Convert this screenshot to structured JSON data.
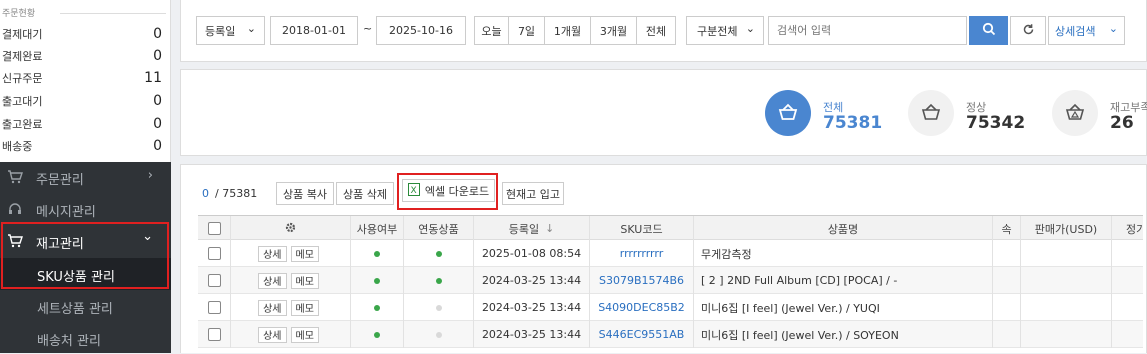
{
  "summary": {
    "title": "주문현황",
    "rows": [
      {
        "label": "결제대기",
        "count": "0"
      },
      {
        "label": "결제완료",
        "count": "0"
      },
      {
        "label": "신규주문",
        "count": "11"
      },
      {
        "label": "출고대기",
        "count": "0"
      },
      {
        "label": "출고완료",
        "count": "0"
      },
      {
        "label": "배송중",
        "count": "0"
      }
    ]
  },
  "nav": {
    "order": "주문관리",
    "message": "메시지관리",
    "inventory": "재고관리",
    "sub_sku": "SKU상품 관리",
    "sub_set": "세트상품 관리",
    "sub_shipper": "배송처 관리",
    "chevron_right": "›",
    "chevron_down": "⌄"
  },
  "filter": {
    "date_type": "등록일",
    "date_from": "2018-01-01",
    "tilde": "~",
    "date_to": "2025-10-16",
    "today": "오늘",
    "d7": "7일",
    "m1": "1개월",
    "m3": "3개월",
    "all": "전체",
    "category": "구분전체",
    "search_placeholder": "검색어 입력",
    "advanced": "상세검색"
  },
  "stats": [
    {
      "label": "전체",
      "value": "75381"
    },
    {
      "label": "정상",
      "value": "75342"
    },
    {
      "label": "재고부족",
      "value": "26"
    }
  ],
  "colors": {
    "accent": "#4a86d0",
    "danger": "#e02020",
    "dot_on": "#3aa64a",
    "dot_off": "#d9d9d9",
    "sidebar": "#2f3337"
  },
  "toolbar": {
    "selected": "0",
    "total": "/ 75381",
    "copy": "상품 복사",
    "delete": "상품 삭제",
    "excel": "엑셀 다운로드",
    "stock_in": "현재고 입고"
  },
  "table": {
    "headers": {
      "use": "사용여부",
      "linked": "연동상품",
      "regdate": "등록일",
      "sku": "SKU코드",
      "name": "상품명",
      "attr": "속",
      "price_sale": "판매가(USD)",
      "price_list": "정가(USD)"
    },
    "detail": "상세",
    "memo": "메모",
    "rows": [
      {
        "use": true,
        "linked": true,
        "date": "2025-01-08 08:54",
        "sku": "rrrrrrrrrr",
        "name": "무게감측정"
      },
      {
        "use": true,
        "linked": true,
        "date": "2024-03-25 13:44",
        "sku": "S3079B1574B6",
        "name": "[ 2 ] 2ND Full Album [CD] [POCA] / -"
      },
      {
        "use": true,
        "linked": false,
        "date": "2024-03-25 13:44",
        "sku": "S4090DEC85B2",
        "name": "미니6집 [I feel] (Jewel Ver.) / YUQI"
      },
      {
        "use": true,
        "linked": false,
        "date": "2024-03-25 13:44",
        "sku": "S446EC9551AB",
        "name": "미니6집 [I feel] (Jewel Ver.) / SOYEON"
      }
    ]
  }
}
